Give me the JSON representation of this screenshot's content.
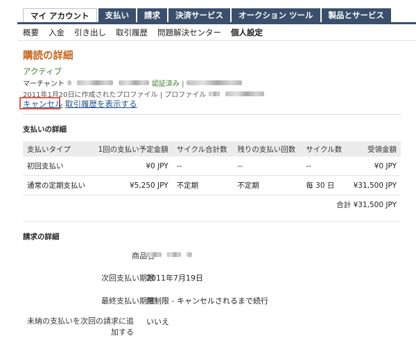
{
  "top_tabs": [
    "マイ アカウント",
    "支払い",
    "請求",
    "決済サービス",
    "オークション ツール",
    "製品とサービス"
  ],
  "sub_nav": [
    "概要",
    "入金",
    "引き出し",
    "取引履歴",
    "問題解決センター",
    "個人設定"
  ],
  "page": {
    "title": "購読の詳細",
    "status": "アクティブ",
    "merchant_label": "マーチャント",
    "verified_label": "認証済み |",
    "profile_created": "2011年1月20日に作成されたプロファイル | プロファイル",
    "cancel_link": "キャンセル",
    "history_link": "取引履歴を表示する"
  },
  "payment": {
    "section_title": "支払いの詳細",
    "headers": [
      "支払いタイプ",
      "1回の支払い予定金額",
      "サイクル合計数",
      "残りの支払い回数",
      "サイクル数",
      "受領金額"
    ],
    "rows": [
      [
        "初回支払い",
        "¥0 JPY",
        "--",
        "--",
        "--",
        "¥0 JPY"
      ],
      [
        "通常の定期支払い",
        "¥5,250 JPY",
        "不定期",
        "不定期",
        "毎 30 日",
        "¥31,500 JPY"
      ]
    ],
    "total": "合計 ¥31,500 JPY"
  },
  "billing": {
    "section_title": "請求の詳細",
    "product_label": "商品名",
    "next_payment_label": "次回支払い期限",
    "next_payment_value": "2011年7月19日",
    "final_payment_label": "最終支払い期限",
    "final_payment_value": "無制限 - キャンセルされるまで続行",
    "add_unpaid_label": "未納の支払いを次回の請求に追加する",
    "add_unpaid_value": "いいえ"
  },
  "colors": {
    "nav": "#3a4f6c",
    "heading": "#c4661f",
    "status": "#3e7a2b",
    "link": "#1f4e8c",
    "highlight": "#e05b4f"
  }
}
